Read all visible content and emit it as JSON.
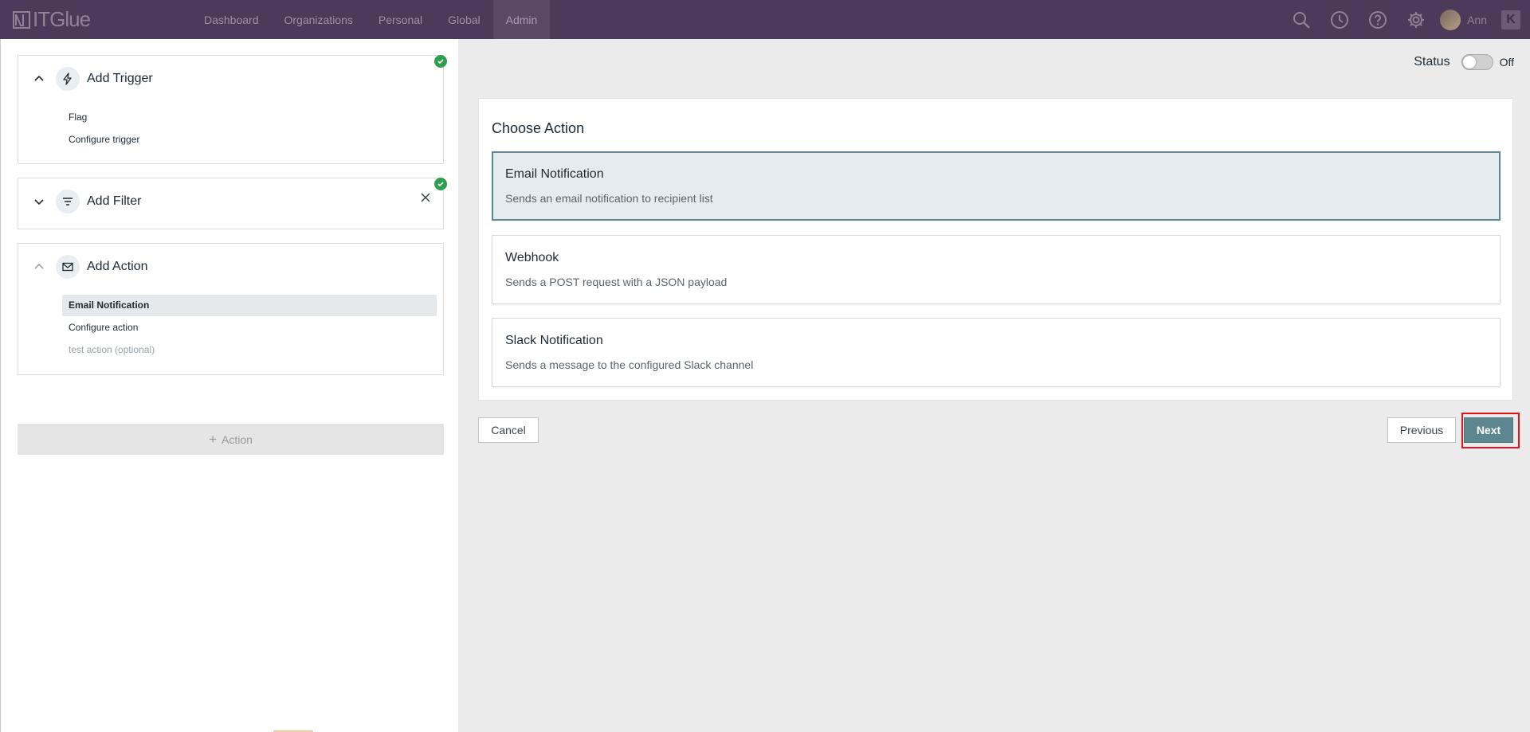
{
  "app": {
    "logo_text": "ITGlue",
    "nav": [
      "Dashboard",
      "Organizations",
      "Personal",
      "Global",
      "Admin"
    ],
    "active_nav": "Admin",
    "user_name": "Ann"
  },
  "steps": {
    "trigger": {
      "title": "Add Trigger",
      "items": [
        "Flag",
        "Configure trigger"
      ]
    },
    "filter": {
      "title": "Add Filter"
    },
    "action": {
      "title": "Add Action",
      "items": [
        "Email Notification",
        "Configure action",
        "test action (optional)"
      ]
    },
    "add_action_label": "Action"
  },
  "status": {
    "label": "Status",
    "value": "Off"
  },
  "choose_action": {
    "title": "Choose Action",
    "options": [
      {
        "title": "Email Notification",
        "description": "Sends an email notification to recipient list"
      },
      {
        "title": "Webhook",
        "description": "Sends a POST request with a JSON payload"
      },
      {
        "title": "Slack Notification",
        "description": "Sends a message to the configured Slack channel"
      }
    ]
  },
  "buttons": {
    "cancel": "Cancel",
    "previous": "Previous",
    "next": "Next"
  },
  "colors": {
    "topbar": "#4b3a59",
    "accent": "#5c8790",
    "success": "#2f9e4f",
    "highlight": "#e0121b"
  }
}
